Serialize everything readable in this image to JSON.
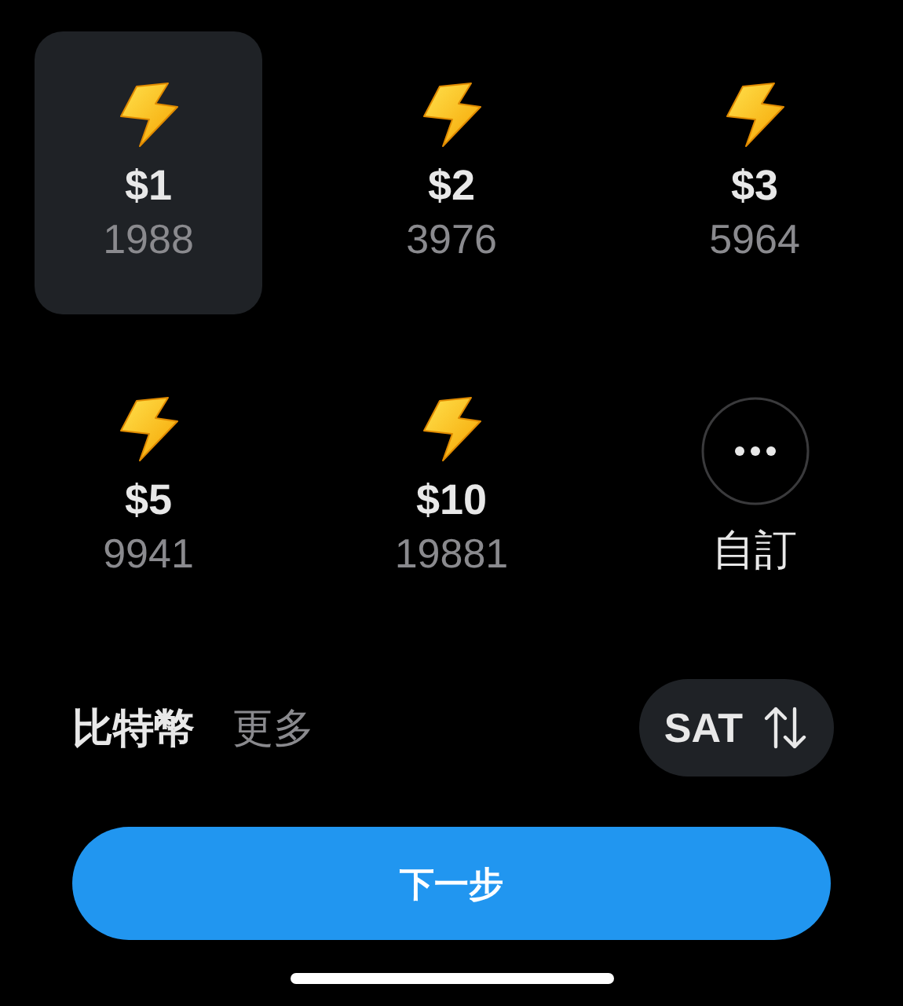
{
  "options": [
    {
      "kind": "amount",
      "amount": "$1",
      "sats": "1988",
      "selected": true
    },
    {
      "kind": "amount",
      "amount": "$2",
      "sats": "3976",
      "selected": false
    },
    {
      "kind": "amount",
      "amount": "$3",
      "sats": "5964",
      "selected": false
    },
    {
      "kind": "amount",
      "amount": "$5",
      "sats": "9941",
      "selected": false
    },
    {
      "kind": "amount",
      "amount": "$10",
      "sats": "19881",
      "selected": false
    },
    {
      "kind": "custom",
      "label": "自訂",
      "selected": false
    }
  ],
  "currency": {
    "label": "比特幣",
    "more": "更多",
    "unit": "SAT"
  },
  "next_button": "下一步"
}
